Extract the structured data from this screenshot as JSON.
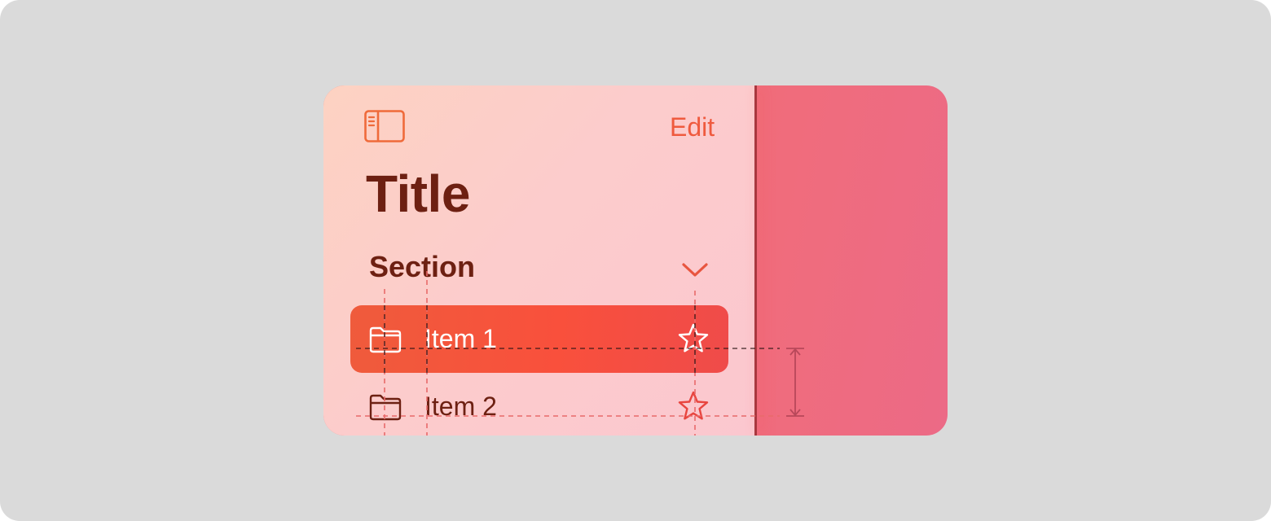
{
  "header": {
    "sidebar_toggle_icon": "sidebar-icon",
    "edit_label": "Edit"
  },
  "title": "Title",
  "section": {
    "label": "Section",
    "chevron_icon": "chevron-down-icon"
  },
  "items": [
    {
      "label": "Item 1",
      "icon": "folder-icon",
      "trailing_icon": "star-icon",
      "selected": true
    },
    {
      "label": "Item 2",
      "icon": "folder-icon",
      "trailing_icon": "star-icon",
      "selected": false
    }
  ],
  "colors": {
    "background": "#dadada",
    "sidebar_tint": "#fccccc",
    "accent": "#ef5a3e",
    "selection": "#f9503c",
    "text_dark": "#6d2012",
    "detail_pane": "#f36e74",
    "guide_line": "#e85a5a"
  }
}
